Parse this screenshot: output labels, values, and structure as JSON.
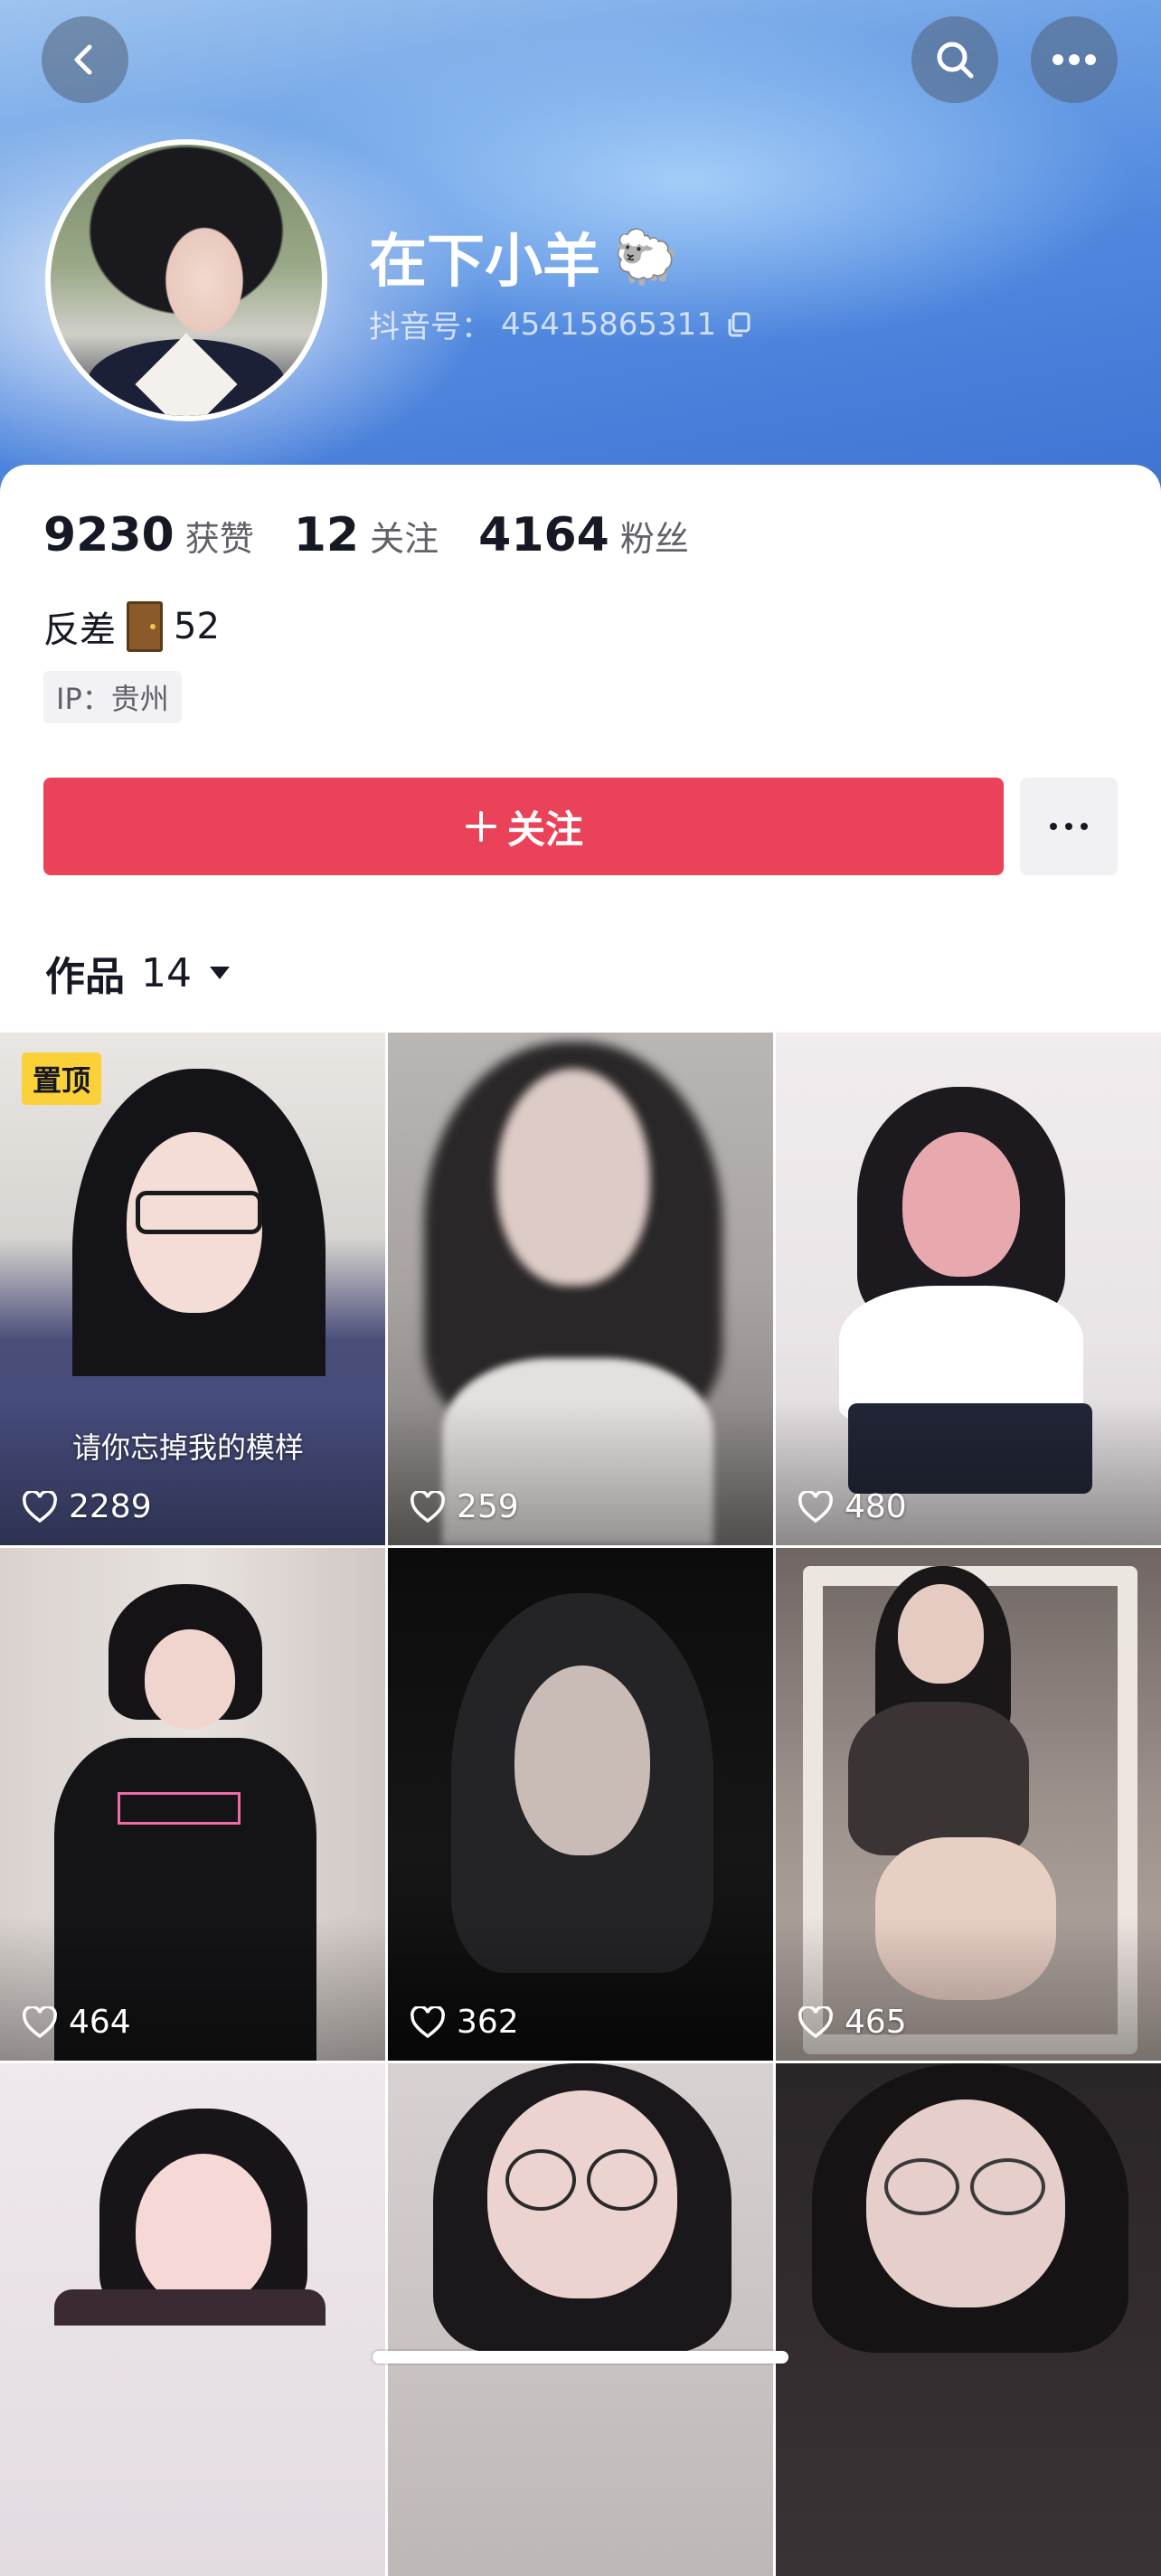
{
  "header": {
    "back_icon": "chevron-left-icon",
    "search_icon": "search-icon",
    "more_icon": "more-horizontal-icon"
  },
  "profile": {
    "nickname": "在下小羊",
    "nickname_emoji": "🐑",
    "douyin_id_label": "抖音号：",
    "douyin_id": "45415865311",
    "copy_icon": "copy-icon"
  },
  "stats": [
    {
      "value": "9230",
      "label": "获赞"
    },
    {
      "value": "12",
      "label": "关注"
    },
    {
      "value": "4164",
      "label": "粉丝"
    }
  ],
  "bio": {
    "prefix": "反差",
    "emoji": "door-emoji",
    "suffix": "52"
  },
  "ip_tag": "IP：贵州",
  "actions": {
    "follow_label": "关注",
    "follow_color": "#ea4359"
  },
  "works": {
    "tab_label": "作品",
    "count": "14"
  },
  "videos": [
    {
      "likes": "2289",
      "pinned_label": "置顶",
      "caption": "请你忘掉我的模样"
    },
    {
      "likes": "259"
    },
    {
      "likes": "480"
    },
    {
      "likes": "464"
    },
    {
      "likes": "362"
    },
    {
      "likes": "465"
    },
    {
      "likes": ""
    },
    {
      "likes": ""
    },
    {
      "likes": ""
    }
  ]
}
